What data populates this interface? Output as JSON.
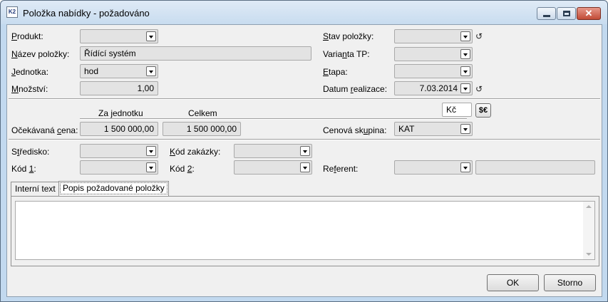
{
  "window": {
    "title": "Položka nabídky - požadováno",
    "app_icon_text": "K2",
    "icons": {
      "app": "app-logo-icon",
      "min": "minimize-icon",
      "max": "maximize-icon",
      "close": "close-icon"
    }
  },
  "form": {
    "produkt": {
      "label_u": "P",
      "label_rest": "rodukt:",
      "value": ""
    },
    "nazev": {
      "label_u": "N",
      "label_rest": "ázev položky:",
      "value": "Řídící systém"
    },
    "jednotka": {
      "label_u": "J",
      "label_rest": "ednotka:",
      "value": "hod"
    },
    "mnozstvi": {
      "label_u": "M",
      "label_rest": "nožství:",
      "value": "1,00"
    },
    "stav": {
      "label_u": "S",
      "label_rest": "tav položky:",
      "value": ""
    },
    "varianta": {
      "label_pre": "Varia",
      "label_u": "n",
      "label_rest": "ta TP:",
      "value": ""
    },
    "etapa": {
      "label_u": "E",
      "label_rest": "tapa:",
      "value": ""
    },
    "datum": {
      "label_pre": "Datum ",
      "label_u": "r",
      "label_rest": "ealizace:",
      "value": "7.03.2014"
    }
  },
  "prices": {
    "col_unit": "Za jednotku",
    "col_total": "Celkem",
    "currency": "Kč",
    "currency_button": "$€",
    "ocekavana": {
      "label_pre": "Očekávaná ",
      "label_u": "c",
      "label_rest": "ena:",
      "unit": "1 500 000,00",
      "total": "1 500 000,00"
    },
    "cenova_skupina": {
      "label_pre": "Cenová sk",
      "label_u": "u",
      "label_rest": "pina:",
      "value": "KAT"
    }
  },
  "bottom": {
    "stredisko": {
      "label_pre": "S",
      "label_u": "t",
      "label_rest": "ředisko:",
      "value": ""
    },
    "kod_zakazky": {
      "label_u": "K",
      "label_rest": "ód zakázky:",
      "value": ""
    },
    "kod1": {
      "label_pre": "Kód ",
      "label_u": "1",
      "label_rest": ":",
      "value": ""
    },
    "kod2": {
      "label_pre": "Kód ",
      "label_u": "2",
      "label_rest": ":",
      "value": ""
    },
    "referent": {
      "label_pre": "Re",
      "label_u": "f",
      "label_rest": "erent:",
      "value": "",
      "name": ""
    }
  },
  "tabs": {
    "interni": "Interní text",
    "popis": "Popis požadované položky",
    "memo_text": ""
  },
  "buttons": {
    "ok": "OK",
    "storno": "Storno"
  }
}
